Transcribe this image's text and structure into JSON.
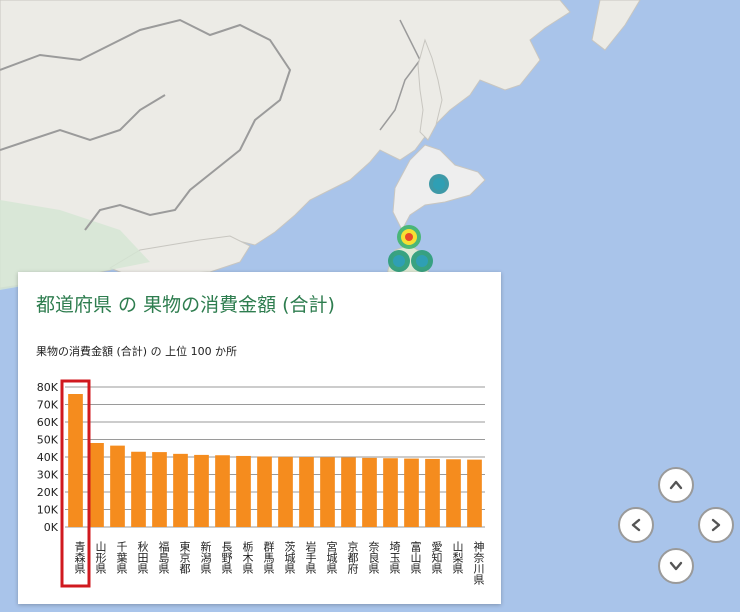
{
  "panel": {
    "title": "都道府県 の 果物の消費金額 (合計)",
    "subtitle": "果物の消費金額 (合計) の 上位 100 か所"
  },
  "map_controls": [
    "pan-up",
    "pan-left",
    "pan-right",
    "pan-down"
  ],
  "heat_markers": [
    {
      "area": "北海道",
      "level": "low"
    },
    {
      "area": "青森県",
      "level": "high"
    },
    {
      "area": "秋田県",
      "level": "low"
    },
    {
      "area": "岩手県",
      "level": "low"
    }
  ],
  "colors": {
    "bar": "#f58c1e",
    "highlight_box": "#d0191f",
    "title": "#2e7d4f",
    "sea": "#a9c4ea",
    "land": "#ecebe6"
  },
  "chart_data": {
    "type": "bar",
    "title": "都道府県 の 果物の消費金額 (合計)",
    "subtitle": "果物の消費金額 (合計) の 上位 100 か所",
    "categories": [
      "青森県",
      "山形県",
      "千葉県",
      "秋田県",
      "福島県",
      "東京都",
      "新潟県",
      "長野県",
      "栃木県",
      "群馬県",
      "茨城県",
      "岩手県",
      "宮城県",
      "京都府",
      "奈良県",
      "埼玉県",
      "富山県",
      "愛知県",
      "山梨県",
      "神奈川県"
    ],
    "values": [
      76000,
      48000,
      46500,
      43000,
      42800,
      41800,
      41200,
      41000,
      40600,
      40300,
      40100,
      40000,
      39900,
      39800,
      39500,
      39300,
      39100,
      38900,
      38700,
      38500
    ],
    "ylim": [
      0,
      80000
    ],
    "yticks": [
      "0K",
      "10K",
      "20K",
      "30K",
      "40K",
      "50K",
      "60K",
      "70K",
      "80K"
    ],
    "highlighted_category": "青森県",
    "grid": true
  }
}
